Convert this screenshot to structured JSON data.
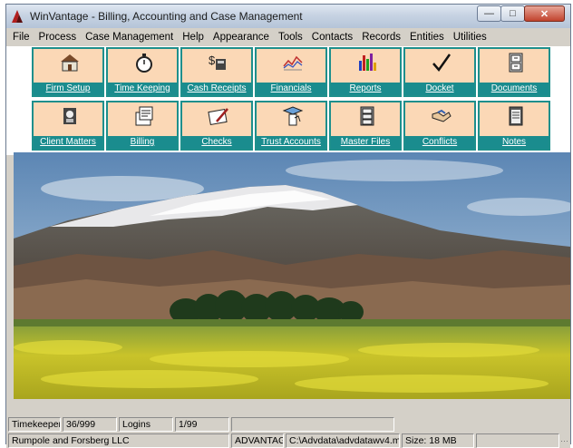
{
  "window": {
    "title": "WinVantage - Billing, Accounting and Case Management"
  },
  "menu": [
    "File",
    "Process",
    "Case Management",
    "Help",
    "Appearance",
    "Tools",
    "Contacts",
    "Records",
    "Entities",
    "Utilities"
  ],
  "toolbar": {
    "row1": [
      {
        "label": "Firm Setup",
        "icon": "house-icon"
      },
      {
        "label": "Time Keeping",
        "icon": "stopwatch-icon"
      },
      {
        "label": "Cash Receipts",
        "icon": "cash-icon"
      },
      {
        "label": "Financials",
        "icon": "line-chart-icon"
      },
      {
        "label": "Reports",
        "icon": "bar-chart-icon"
      },
      {
        "label": "Docket",
        "icon": "checkmark-icon"
      },
      {
        "label": "Documents",
        "icon": "file-cabinet-icon"
      }
    ],
    "row2": [
      {
        "label": "Client Matters",
        "icon": "client-icon"
      },
      {
        "label": "Billing",
        "icon": "invoice-icon"
      },
      {
        "label": "Checks",
        "icon": "checkbook-icon"
      },
      {
        "label": "Trust Accounts",
        "icon": "trust-icon"
      },
      {
        "label": "Master Files",
        "icon": "cabinet-icon"
      },
      {
        "label": "Conflicts",
        "icon": "handshake-icon"
      },
      {
        "label": "Notes",
        "icon": "notepad-icon"
      }
    ]
  },
  "status": {
    "timekeepers_label": "Timekeepers",
    "timekeepers_value": "36/999",
    "logins_label": "Logins",
    "logins_value": "1/99",
    "firm": "Rumpole and Forsberg LLC",
    "db": "ADVANTAG",
    "path": "C:\\Advdata\\advdatawv4.m",
    "size": "Size: 18 MB"
  },
  "colors": {
    "button_bg": "#fbd8b6",
    "button_label_bg": "#1a8c8e",
    "chrome": "#d4d0c8"
  }
}
